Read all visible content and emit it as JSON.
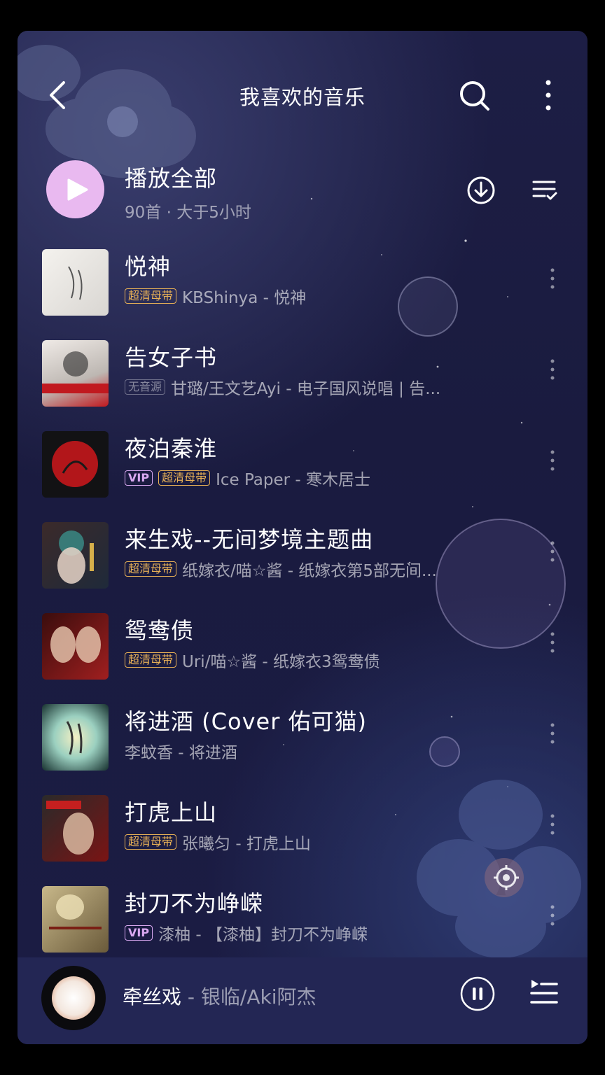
{
  "header": {
    "title": "我喜欢的音乐",
    "back_icon": "chevron-left-icon",
    "search_icon": "search-icon",
    "more_icon": "more-vertical-icon"
  },
  "play_all": {
    "label": "播放全部",
    "meta": "90首 · 大于5小时",
    "download_icon": "download-icon",
    "multiselect_icon": "list-check-icon"
  },
  "songs": [
    {
      "title": "悦神",
      "badges": [
        "超清母带"
      ],
      "subtitle": "KBShinya - 悦神"
    },
    {
      "title": "告女子书",
      "badges": [
        "无音源"
      ],
      "subtitle": "甘璐/王文艺Ayi - 电子国风说唱 | 告..."
    },
    {
      "title": "夜泊秦淮",
      "badges": [
        "VIP",
        "超清母带"
      ],
      "subtitle": "Ice Paper - 寒木居士"
    },
    {
      "title": "来生戏--无间梦境主题曲",
      "badges": [
        "超清母带"
      ],
      "subtitle": "纸嫁衣/喵☆酱 - 纸嫁衣第5部无间..."
    },
    {
      "title": "鸳鸯债",
      "badges": [
        "超清母带"
      ],
      "subtitle": "Uri/喵☆酱 - 纸嫁衣3鸳鸯债"
    },
    {
      "title": "将进酒 (Cover 佑可猫)",
      "badges": [],
      "subtitle": "李蚊香 - 将进酒"
    },
    {
      "title": "打虎上山",
      "badges": [
        "超清母带"
      ],
      "subtitle": "张曦匀 - 打虎上山"
    },
    {
      "title": "封刀不为峥嵘",
      "badges": [
        "VIP"
      ],
      "subtitle": "漆柚 - 【漆柚】封刀不为峥嵘"
    }
  ],
  "now_playing": {
    "title": "牵丝戏",
    "artist": " - 银临/Aki阿杰",
    "pause_icon": "pause-icon",
    "playlist_icon": "playlist-icon"
  },
  "colors": {
    "background": "#1b1c44",
    "play_all_button": "#e9b9f0",
    "badge_hq": "#e7b056",
    "badge_vip": "#d8a8f0",
    "mini_player": "#232654"
  }
}
